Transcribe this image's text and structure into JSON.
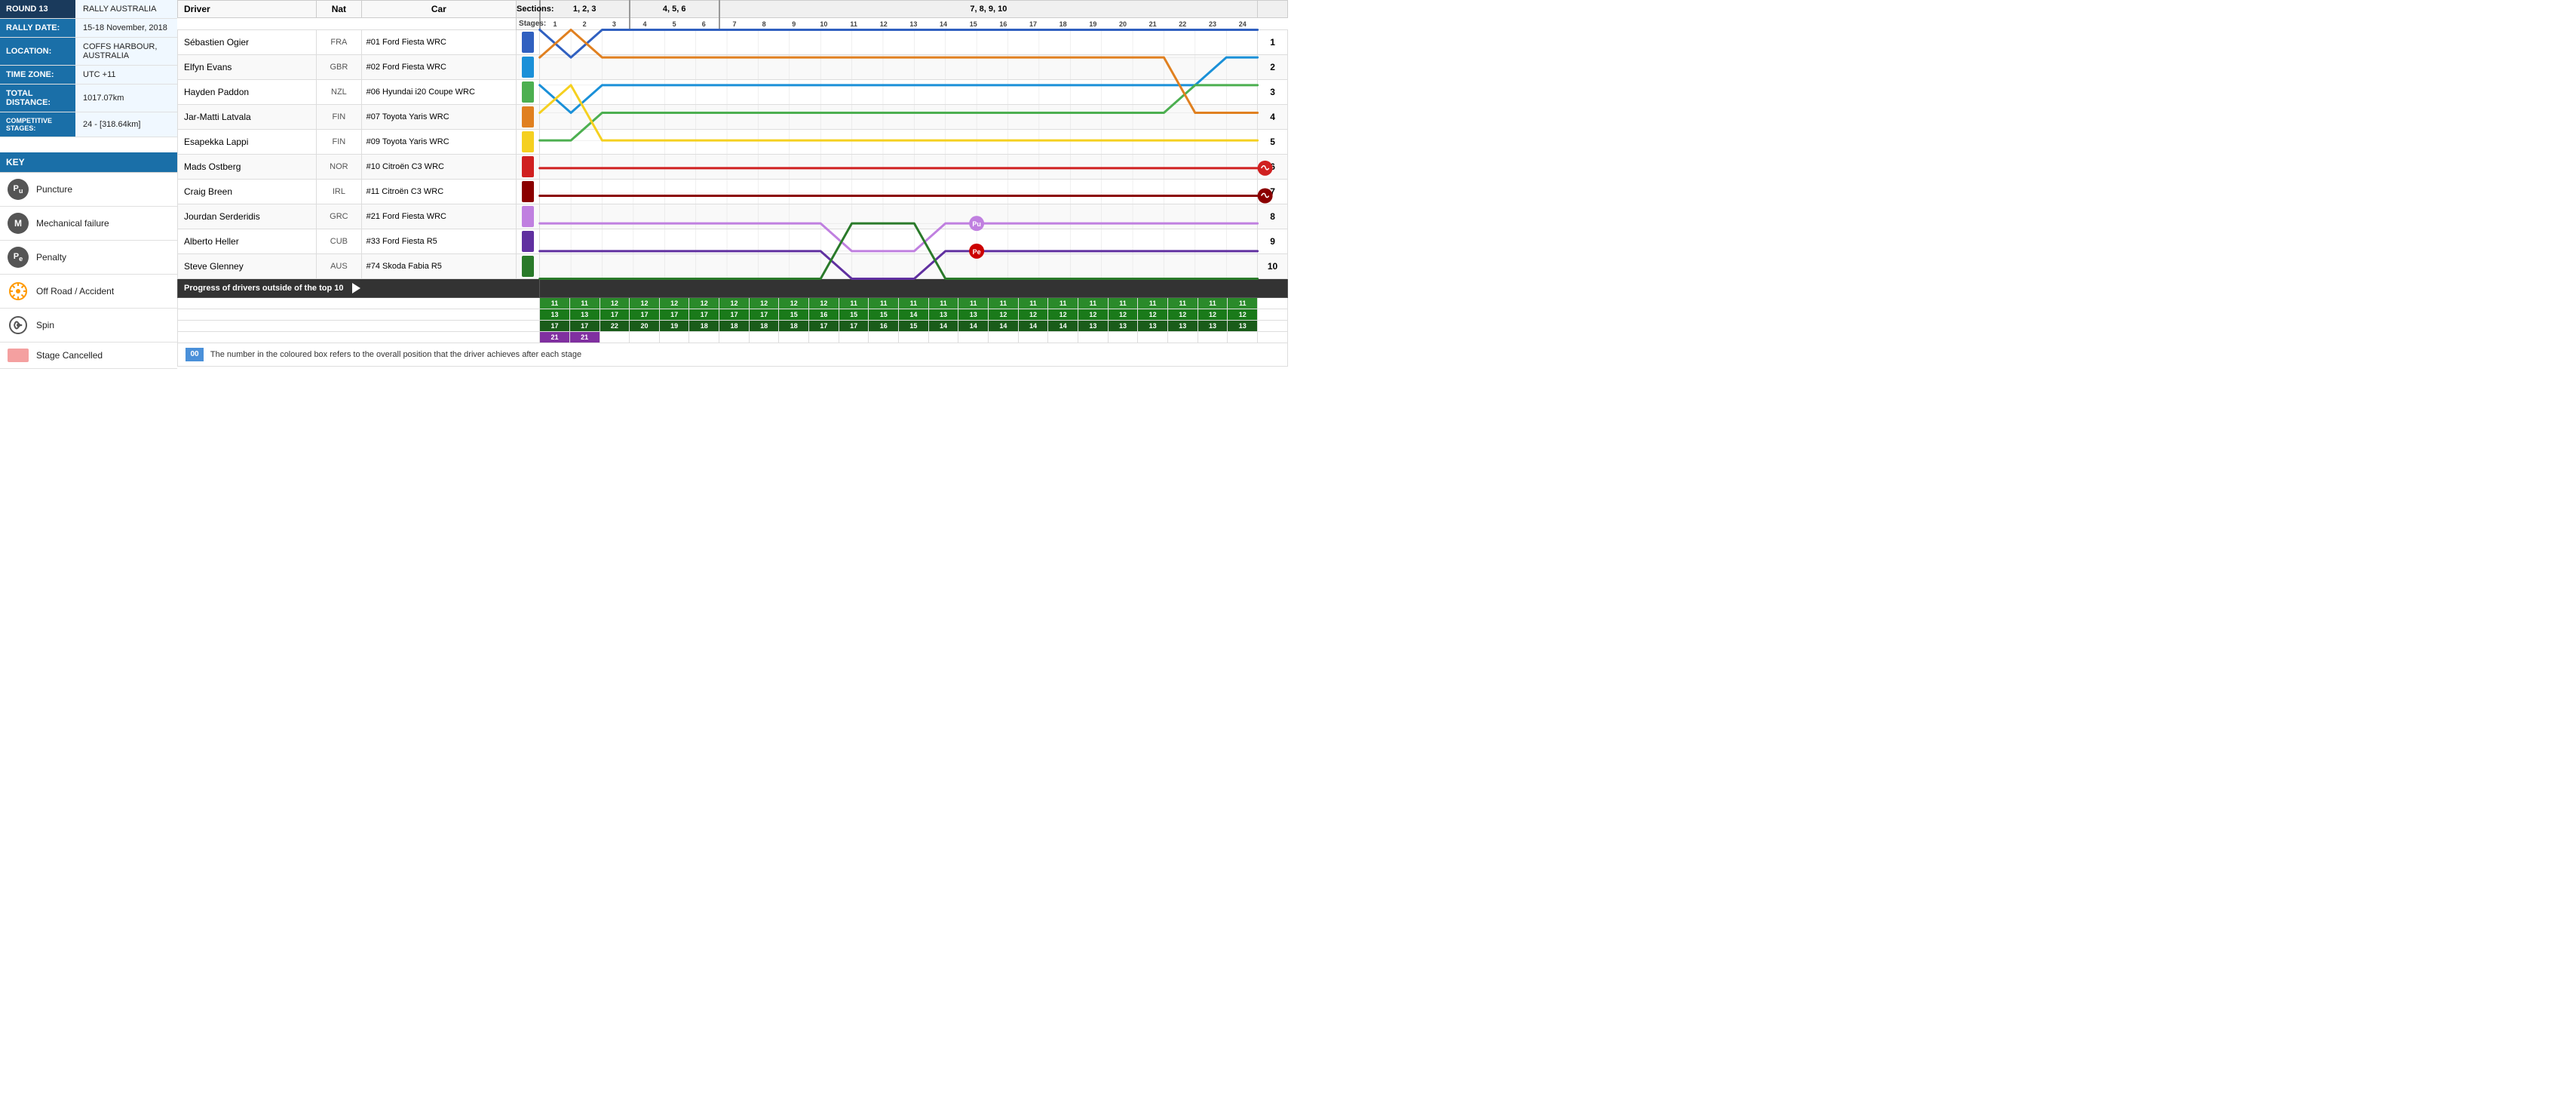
{
  "left": {
    "round": {
      "label": "ROUND 13",
      "value": "RALLY AUSTRALIA"
    },
    "rallyDate": {
      "label": "RALLY DATE:",
      "value": "15-18 November, 2018"
    },
    "location": {
      "label": "LOCATION:",
      "value": "COFFS HARBOUR, AUSTRALIA"
    },
    "timeZone": {
      "label": "TIME ZONE:",
      "value": "UTC +11"
    },
    "totalDistance": {
      "label": "TOTAL DISTANCE:",
      "value": "1017.07km"
    },
    "competitiveStages": {
      "label": "COMPETITIVE STAGES:",
      "value": "24 - [318.64km]"
    },
    "key": {
      "title": "KEY",
      "items": [
        {
          "id": "puncture",
          "symbol": "Pu",
          "label": "Puncture"
        },
        {
          "id": "mechanical",
          "symbol": "M",
          "label": "Mechanical failure"
        },
        {
          "id": "penalty",
          "symbol": "Pe",
          "label": "Penalty"
        },
        {
          "id": "offroad",
          "symbol": "✦",
          "label": "Off Road / Accident"
        },
        {
          "id": "spin",
          "symbol": "⊛",
          "label": "Spin"
        },
        {
          "id": "stage-cancelled",
          "symbol": "",
          "label": "Stage Cancelled"
        }
      ]
    }
  },
  "table": {
    "headers": {
      "driver": "Driver",
      "nat": "Nat",
      "car": "Car",
      "sections": "Sections:",
      "sec123": "1, 2, 3",
      "sec456": "4, 5, 6",
      "sec78910": "7, 8, 9, 10",
      "stagesLabel": "Stages:"
    },
    "stages": [
      "1",
      "2",
      "3",
      "4",
      "5",
      "6",
      "7",
      "8",
      "9",
      "10",
      "11",
      "12",
      "13",
      "14",
      "15",
      "16",
      "17",
      "18",
      "19",
      "20",
      "21",
      "22",
      "23",
      "24"
    ],
    "drivers": [
      {
        "name": "Sébastien Ogier",
        "nat": "FRA",
        "car": "#01  Ford Fiesta WRC",
        "color": "#3060c0",
        "pos": 1
      },
      {
        "name": "Elfyn Evans",
        "nat": "GBR",
        "car": "#02  Ford Fiesta WRC",
        "color": "#1a90d8",
        "pos": 2
      },
      {
        "name": "Hayden Paddon",
        "nat": "NZL",
        "car": "#06  Hyundai i20 Coupe WRC",
        "color": "#4caf50",
        "pos": 3
      },
      {
        "name": "Jar-Matti Latvala",
        "nat": "FIN",
        "car": "#07  Toyota Yaris WRC",
        "color": "#e08020",
        "pos": 4
      },
      {
        "name": "Esapekka Lappi",
        "nat": "FIN",
        "car": "#09  Toyota Yaris WRC",
        "color": "#f5d020",
        "pos": 5
      },
      {
        "name": "Mads Ostberg",
        "nat": "NOR",
        "car": "#10  Citroën C3 WRC",
        "color": "#d02020",
        "pos": 6
      },
      {
        "name": "Craig Breen",
        "nat": "IRL",
        "car": "#11  Citroën C3 WRC",
        "color": "#8b0000",
        "pos": 7
      },
      {
        "name": "Jourdan Serderidis",
        "nat": "GRC",
        "car": "#21  Ford Fiesta WRC",
        "color": "#c080e0",
        "pos": 8
      },
      {
        "name": "Alberto Heller",
        "nat": "CUB",
        "car": "#33  Ford Fiesta R5",
        "color": "#6030a0",
        "pos": 9
      },
      {
        "name": "Steve Glenney",
        "nat": "AUS",
        "car": "#74  Skoda Fabia R5",
        "color": "#2a7a2a",
        "pos": 10
      }
    ],
    "progressLabel": "Progress of drivers outside of the top 10",
    "legendText": "The number in the coloured box refers to the overall position that the driver achieves after each stage",
    "legendBoxText": "00",
    "bottomRows": [
      {
        "positions": [
          "11",
          "11",
          "12",
          "12",
          "12",
          "12",
          "12",
          "12",
          "12",
          "12",
          "11",
          "11",
          "11",
          "11",
          "11",
          "11",
          "11",
          "11",
          "11",
          "11",
          "11",
          "11",
          "11",
          "11"
        ],
        "color": "green"
      },
      {
        "positions": [
          "13",
          "13",
          "17",
          "17",
          "17",
          "17",
          "17",
          "17",
          "15",
          "16",
          "15",
          "15",
          "14",
          "13",
          "13",
          "12",
          "12",
          "12",
          "12",
          "12",
          "12",
          "12",
          "12",
          "12"
        ],
        "color": "green"
      },
      {
        "positions": [
          "17",
          "17",
          "22",
          "20",
          "19",
          "18",
          "18",
          "18",
          "18",
          "17",
          "17",
          "16",
          "15",
          "14",
          "14",
          "14",
          "14",
          "14",
          "13",
          "13",
          "13",
          "13",
          "13",
          "13"
        ],
        "color": "dark-green"
      },
      {
        "positions": [
          "21",
          "21"
        ],
        "color": "purple"
      }
    ]
  }
}
